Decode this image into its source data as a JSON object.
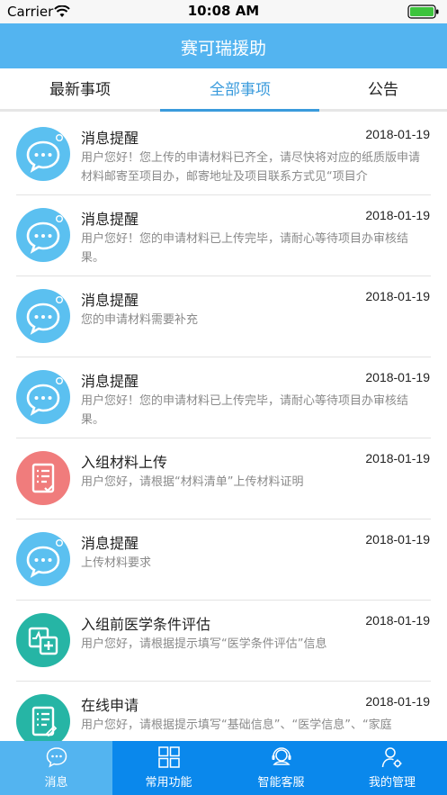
{
  "status_bar": {
    "carrier": "Carrier",
    "time": "10:08 AM"
  },
  "nav": {
    "title": "赛可瑞援助"
  },
  "tabs": [
    {
      "label": "最新事项"
    },
    {
      "label": "全部事项"
    },
    {
      "label": "公告"
    }
  ],
  "active_tab": "全部事项",
  "items": [
    {
      "title": "消息提醒",
      "date": "2018-01-19",
      "desc": "用户您好！您上传的申请材料已齐全，请尽快将对应的纸质版申请材料邮寄至项目办，邮寄地址及项目联系方式见“项目介",
      "icon": "message-bubble-icon",
      "color": "#5bc0f0"
    },
    {
      "title": "消息提醒",
      "date": "2018-01-19",
      "desc": "用户您好！您的申请材料已上传完毕，请耐心等待项目办审核结果。",
      "icon": "message-bubble-icon",
      "color": "#5bc0f0"
    },
    {
      "title": "消息提醒",
      "date": "2018-01-19",
      "desc": "您的申请材料需要补充",
      "icon": "message-bubble-icon",
      "color": "#5bc0f0"
    },
    {
      "title": "消息提醒",
      "date": "2018-01-19",
      "desc": "用户您好！您的申请材料已上传完毕，请耐心等待项目办审核结果。",
      "icon": "message-bubble-icon",
      "color": "#5bc0f0"
    },
    {
      "title": "入组材料上传",
      "date": "2018-01-19",
      "desc": "用户您好，请根据“材料清单”上传材料证明",
      "icon": "document-checklist-icon",
      "color": "#f07c7c"
    },
    {
      "title": "消息提醒",
      "date": "2018-01-19",
      "desc": "上传材料要求",
      "icon": "message-bubble-icon",
      "color": "#5bc0f0"
    },
    {
      "title": "入组前医学条件评估",
      "date": "2018-01-19",
      "desc": "用户您好，请根据提示填写“医学条件评估”信息",
      "icon": "medical-assessment-icon",
      "color": "#26b5a5"
    },
    {
      "title": "在线申请",
      "date": "2018-01-19",
      "desc": "用户您好，请根据提示填写“基础信息”、“医学信息”、“家庭",
      "icon": "online-application-icon",
      "color": "#26b5a5"
    }
  ],
  "tabbar": [
    {
      "label": "消息",
      "icon": "chat-icon"
    },
    {
      "label": "常用功能",
      "icon": "grid-icon"
    },
    {
      "label": "智能客服",
      "icon": "headset-icon"
    },
    {
      "label": "我的管理",
      "icon": "user-gear-icon"
    }
  ],
  "active_tabbar": "消息",
  "colors": {
    "nav": "#53b4f0",
    "tab_active": "#3a9bdc",
    "tabbar": "#0a88ec",
    "tabbar_active": "#53b4f0"
  }
}
